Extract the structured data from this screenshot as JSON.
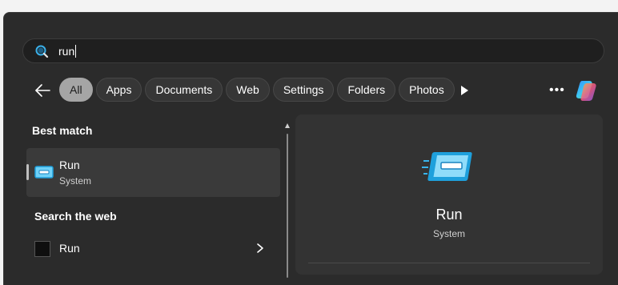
{
  "search": {
    "value": "run"
  },
  "filters": [
    "All",
    "Apps",
    "Documents",
    "Web",
    "Settings",
    "Folders",
    "Photos"
  ],
  "active_filter": "All",
  "more_label": "•••",
  "best_match": {
    "heading": "Best match",
    "item": {
      "title": "Run",
      "subtitle": "System"
    }
  },
  "web": {
    "heading": "Search the web",
    "item": {
      "title": "Run"
    }
  },
  "preview": {
    "title": "Run",
    "subtitle": "System"
  },
  "icons": [
    "search-icon",
    "back-arrow-icon",
    "play-icon",
    "more-icon",
    "copilot-icon",
    "run-app-icon",
    "chevron-right-icon",
    "scroll-up-icon"
  ],
  "colors": {
    "panel": "#2b2b2b",
    "active_chip": "#a5a5a5",
    "accent_blue": "#29a9e8"
  }
}
